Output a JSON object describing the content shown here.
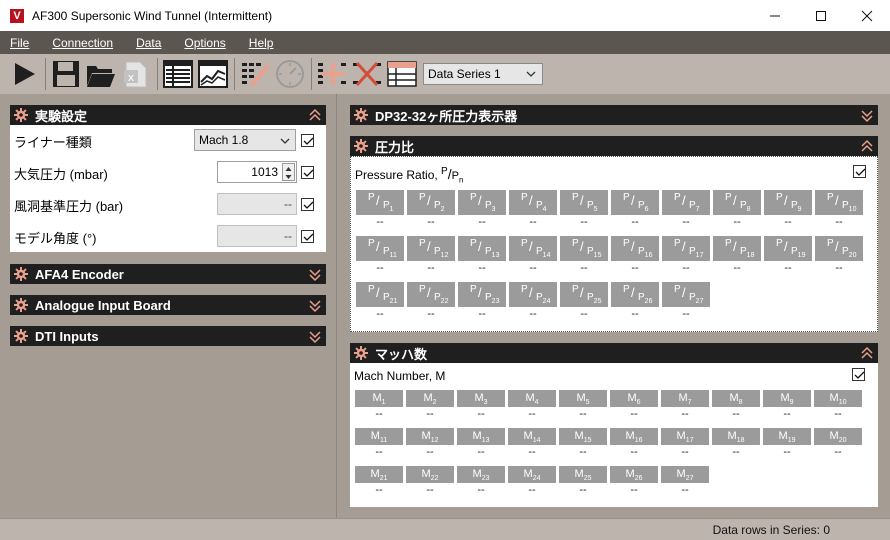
{
  "window": {
    "title": "AF300 Supersonic Wind Tunnel (Intermittent)",
    "logo_letter": "V"
  },
  "menu": [
    {
      "label": "File"
    },
    {
      "label": "Connection"
    },
    {
      "label": "Data"
    },
    {
      "label": "Options"
    },
    {
      "label": "Help"
    }
  ],
  "toolbar": {
    "series_selected": "Data Series 1"
  },
  "experiment": {
    "title": "実験設定",
    "rows": [
      {
        "label": "ライナー種類",
        "value": "Mach 1.8"
      },
      {
        "label": "大気圧力 (mbar)",
        "value": "1013"
      },
      {
        "label": "風洞基準圧力 (bar)",
        "value": "--"
      },
      {
        "label": "モデル角度 (°)",
        "value": "--"
      }
    ]
  },
  "left_panels": {
    "afa4": "AFA4 Encoder",
    "analogue": "Analogue Input Board",
    "dti": "DTI Inputs"
  },
  "dp32": {
    "title": "DP32-32ヶ所圧力表示器"
  },
  "pressure": {
    "title": "圧力比",
    "caption": "Pressure Ratio,",
    "caption_p": "P",
    "caption_slash": "/",
    "caption_pn": "P",
    "caption_n": "n",
    "cells": [
      {
        "sub": "1",
        "value": "--"
      },
      {
        "sub": "2",
        "value": "--"
      },
      {
        "sub": "3",
        "value": "--"
      },
      {
        "sub": "4",
        "value": "--"
      },
      {
        "sub": "5",
        "value": "--"
      },
      {
        "sub": "6",
        "value": "--"
      },
      {
        "sub": "7",
        "value": "--"
      },
      {
        "sub": "8",
        "value": "--"
      },
      {
        "sub": "9",
        "value": "--"
      },
      {
        "sub": "10",
        "value": "--"
      },
      {
        "sub": "11",
        "value": "--"
      },
      {
        "sub": "12",
        "value": "--"
      },
      {
        "sub": "13",
        "value": "--"
      },
      {
        "sub": "14",
        "value": "--"
      },
      {
        "sub": "15",
        "value": "--"
      },
      {
        "sub": "16",
        "value": "--"
      },
      {
        "sub": "17",
        "value": "--"
      },
      {
        "sub": "18",
        "value": "--"
      },
      {
        "sub": "19",
        "value": "--"
      },
      {
        "sub": "20",
        "value": "--"
      },
      {
        "sub": "21",
        "value": "--"
      },
      {
        "sub": "22",
        "value": "--"
      },
      {
        "sub": "23",
        "value": "--"
      },
      {
        "sub": "24",
        "value": "--"
      },
      {
        "sub": "25",
        "value": "--"
      },
      {
        "sub": "26",
        "value": "--"
      },
      {
        "sub": "27",
        "value": "--"
      }
    ]
  },
  "mach": {
    "title": "マッハ数",
    "caption": "Mach Number, M",
    "cells": [
      {
        "sub": "1",
        "value": "--"
      },
      {
        "sub": "2",
        "value": "--"
      },
      {
        "sub": "3",
        "value": "--"
      },
      {
        "sub": "4",
        "value": "--"
      },
      {
        "sub": "5",
        "value": "--"
      },
      {
        "sub": "6",
        "value": "--"
      },
      {
        "sub": "7",
        "value": "--"
      },
      {
        "sub": "8",
        "value": "--"
      },
      {
        "sub": "9",
        "value": "--"
      },
      {
        "sub": "10",
        "value": "--"
      },
      {
        "sub": "11",
        "value": "--"
      },
      {
        "sub": "12",
        "value": "--"
      },
      {
        "sub": "13",
        "value": "--"
      },
      {
        "sub": "14",
        "value": "--"
      },
      {
        "sub": "15",
        "value": "--"
      },
      {
        "sub": "16",
        "value": "--"
      },
      {
        "sub": "17",
        "value": "--"
      },
      {
        "sub": "18",
        "value": "--"
      },
      {
        "sub": "19",
        "value": "--"
      },
      {
        "sub": "20",
        "value": "--"
      },
      {
        "sub": "21",
        "value": "--"
      },
      {
        "sub": "22",
        "value": "--"
      },
      {
        "sub": "23",
        "value": "--"
      },
      {
        "sub": "24",
        "value": "--"
      },
      {
        "sub": "25",
        "value": "--"
      },
      {
        "sub": "26",
        "value": "--"
      },
      {
        "sub": "27",
        "value": "--"
      }
    ]
  },
  "status": {
    "text": "Data rows in Series: 0"
  },
  "colors": {
    "accent": "#e9a08d",
    "header": "#1f1f1f",
    "cell": "#9b9b9b",
    "menubar": "#5c5650"
  },
  "icons": [
    "play-icon",
    "save-icon",
    "open-folder-icon",
    "excel-icon",
    "table-icon",
    "graph-icon",
    "edit-table-icon",
    "gauge-icon",
    "add-row-icon",
    "delete-icon",
    "series-table-icon",
    "gear-icon",
    "collapse-icon"
  ]
}
